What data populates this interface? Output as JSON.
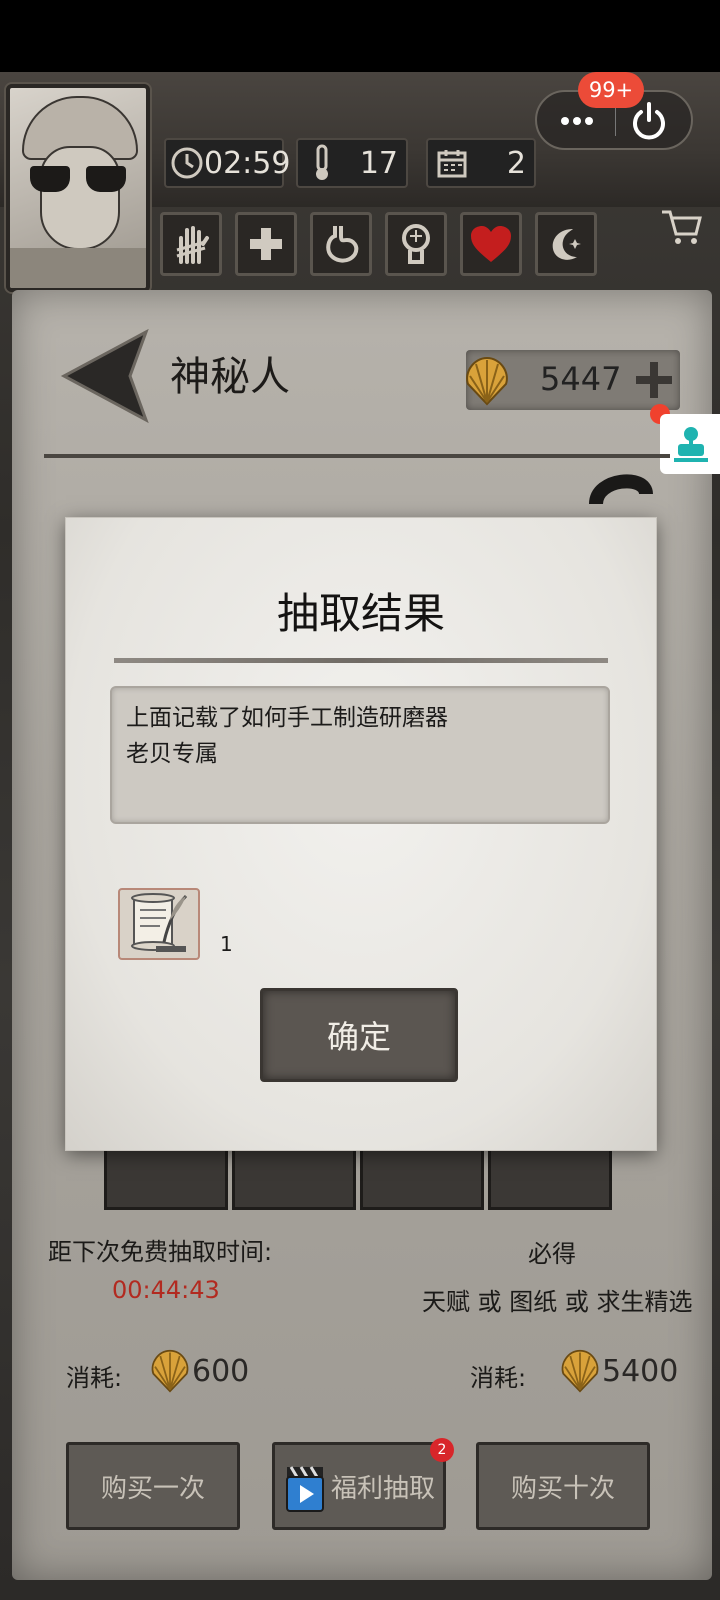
{
  "hud": {
    "time": "02:59",
    "temperature": "17",
    "day": "2",
    "notification_badge": "99+"
  },
  "panel": {
    "title": "神秘人",
    "shells": "5447"
  },
  "modal": {
    "title": "抽取结果",
    "description_line1": "上面记载了如何手工制造研磨器",
    "description_line2": "老贝专属",
    "item_count": "1",
    "ok_label": "确定"
  },
  "draw": {
    "next_free_label": "距下次免费抽取时间:",
    "countdown": "00:44:43",
    "guarantee_label": "必得",
    "guarantee_detail": "天赋 或 图纸 或 求生精选",
    "cost_label_1": "消耗:",
    "cost_value_1": "600",
    "cost_label_10": "消耗:",
    "cost_value_10": "5400"
  },
  "buttons": {
    "buy_once": "购买一次",
    "bonus_draw": "福利抽取",
    "bonus_badge": "2",
    "buy_ten": "购买十次"
  },
  "colors": {
    "accent_red": "#ec4b38",
    "countdown_red": "#b22a20",
    "shell_gold": "#d9a23a"
  }
}
